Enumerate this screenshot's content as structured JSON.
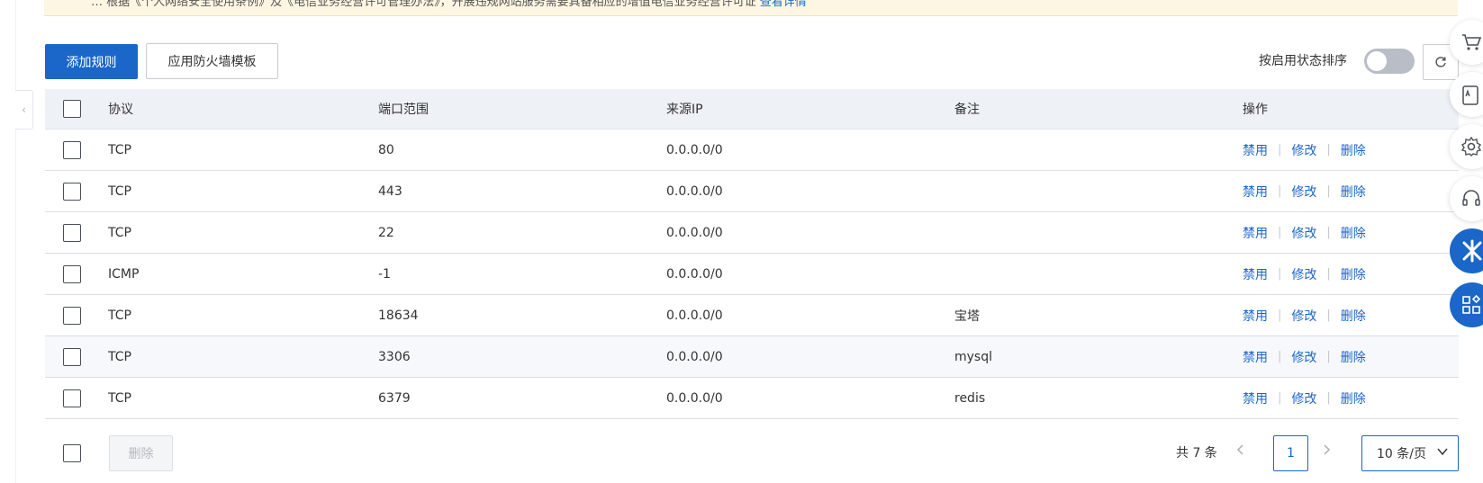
{
  "notice": {
    "text": "… 根据《个人网络安全使用条例》及《电信业务经营许可管理办法》，开展违规网站服务需要具备相应的增值电信业务经营许可证",
    "link": "查看详情"
  },
  "toolbar": {
    "add_rule": "添加规则",
    "apply_template": "应用防火墙模板",
    "sort_label": "按启用状态排序"
  },
  "table": {
    "headers": [
      "协议",
      "端口范围",
      "来源IP",
      "备注",
      "操作"
    ],
    "rows": [
      {
        "protocol": "TCP",
        "port": "80",
        "source": "0.0.0.0/0",
        "note": ""
      },
      {
        "protocol": "TCP",
        "port": "443",
        "source": "0.0.0.0/0",
        "note": ""
      },
      {
        "protocol": "TCP",
        "port": "22",
        "source": "0.0.0.0/0",
        "note": ""
      },
      {
        "protocol": "ICMP",
        "port": "-1",
        "source": "0.0.0.0/0",
        "note": ""
      },
      {
        "protocol": "TCP",
        "port": "18634",
        "source": "0.0.0.0/0",
        "note": "宝塔"
      },
      {
        "protocol": "TCP",
        "port": "3306",
        "source": "0.0.0.0/0",
        "note": "mysql"
      },
      {
        "protocol": "TCP",
        "port": "6379",
        "source": "0.0.0.0/0",
        "note": "redis"
      }
    ],
    "ops": {
      "disable": "禁用",
      "modify": "修改",
      "delete": "删除"
    }
  },
  "footer": {
    "bulk_delete": "删除",
    "total": "共 7 条",
    "current_page": "1",
    "page_size": "10 条/页"
  },
  "icons": {
    "prev": "chevron-left-icon",
    "next": "chevron-right-icon",
    "refresh": "refresh-icon",
    "collapse": "chevron-left-icon"
  },
  "colors": {
    "primary": "#1a66c9",
    "header_bg": "#eef1f6",
    "notice_bg": "#fdf6e3"
  }
}
